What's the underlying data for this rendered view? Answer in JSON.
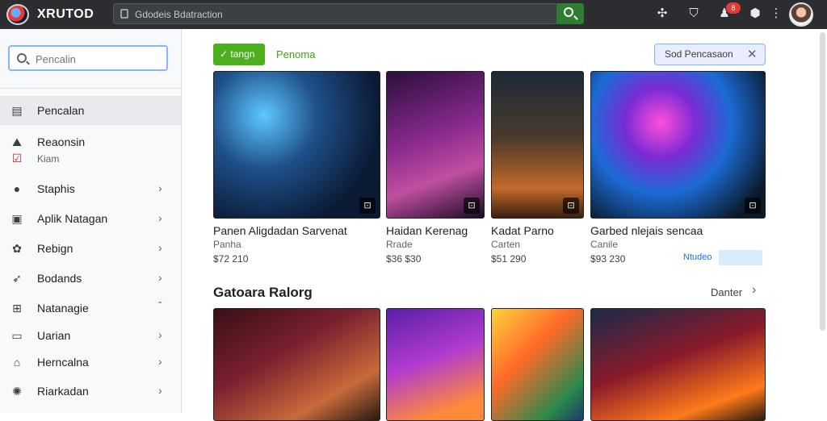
{
  "app": {
    "brand": "XRUTOD"
  },
  "topbar": {
    "search_text": "Gdodeis Bdatraction",
    "icons": [
      "search-icon",
      "controller-icon",
      "bookmark-icon",
      "notifications-icon",
      "shield-icon",
      "more-icon"
    ],
    "notification_count": "8"
  },
  "sidebar": {
    "search_placeholder": "Pencalin",
    "items": [
      {
        "label": "Pencalan",
        "icon": "home-icon",
        "active": true
      },
      {
        "label": "Reaonsin",
        "sub": "Kiam",
        "icon": "library-icon"
      },
      {
        "label": "Staphis",
        "icon": "chat-icon"
      },
      {
        "label": "Aplik Natagan",
        "icon": "apps-icon"
      },
      {
        "label": "Rebign",
        "icon": "gear-icon"
      },
      {
        "label": "Bodands",
        "icon": "rocket-icon"
      },
      {
        "label": "Natanagie",
        "icon": "grid-icon"
      },
      {
        "label": "Uarian",
        "icon": "window-icon"
      },
      {
        "label": "Herncalna",
        "icon": "store-icon"
      },
      {
        "label": "Riarkadan",
        "icon": "settings-icon"
      }
    ]
  },
  "main": {
    "action_button": "tangn",
    "filter_label": "Penoma",
    "chip_label": "Sod Pencasaon",
    "featured": [
      {
        "title": "Panen Aligdadan Sarvenat",
        "sub": "Panha",
        "price": "$72 210"
      },
      {
        "title": "Haidan Kerenag",
        "sub": "Rrade",
        "price": "$36 $30"
      },
      {
        "title": "Kadat Parno",
        "sub": "Carten",
        "price": "$51 290"
      },
      {
        "title": "Garbed nlejais sencaa",
        "sub": "Canile",
        "price": "$93 230",
        "promo": "Ntudeo"
      }
    ],
    "section_title": "Gatoara Ralorg",
    "see_all": "Danter"
  },
  "colors": {
    "accent_green": "#4caf1e",
    "topbar": "#2b2d30",
    "chip": "#e8eefc"
  }
}
